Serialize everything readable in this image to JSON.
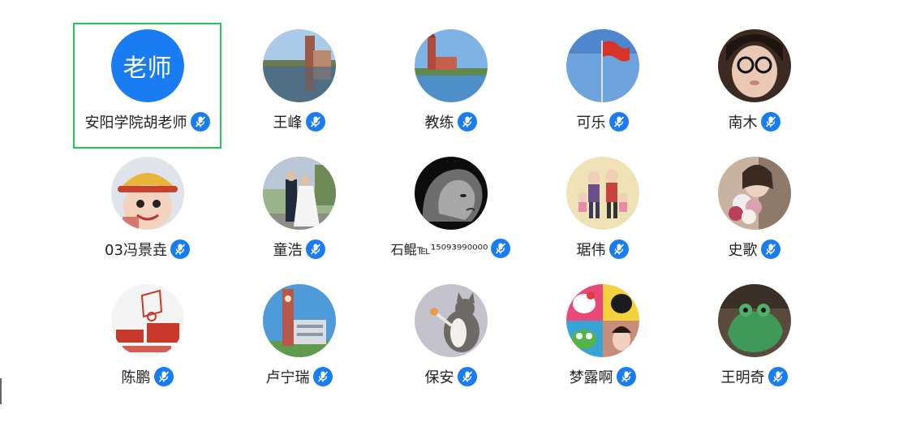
{
  "participants": [
    {
      "name": "安阳学院胡老师",
      "avatar_text": "老师",
      "avatar_type": "initials",
      "avatar_color": "#1a7cf2",
      "selected": true
    },
    {
      "name": "王峰",
      "avatar_type": "photo",
      "avatar_icon": "lake-building-photo"
    },
    {
      "name": "教练",
      "avatar_type": "photo",
      "avatar_icon": "tower-lake-photo"
    },
    {
      "name": "可乐",
      "avatar_type": "photo",
      "avatar_icon": "flag-sky-photo"
    },
    {
      "name": "南木",
      "avatar_type": "photo",
      "avatar_icon": "girl-glasses-photo"
    },
    {
      "name": "03冯景垚",
      "avatar_type": "photo",
      "avatar_icon": "anime-character-photo"
    },
    {
      "name": "童浩",
      "avatar_type": "photo",
      "avatar_icon": "wedding-couple-photo"
    },
    {
      "name": "石鲲℡¹⁵⁰⁹³⁹⁹⁰⁰⁰⁰",
      "avatar_type": "photo",
      "avatar_icon": "lion-photo"
    },
    {
      "name": "琚伟",
      "avatar_type": "photo",
      "avatar_icon": "family-cartoon-photo"
    },
    {
      "name": "史歌",
      "avatar_type": "photo",
      "avatar_icon": "girl-flowers-photo"
    },
    {
      "name": "陈鹏",
      "avatar_type": "photo",
      "avatar_icon": "basketball-logo-photo"
    },
    {
      "name": "卢宁瑞",
      "avatar_type": "photo",
      "avatar_icon": "clock-tower-photo"
    },
    {
      "name": "保安",
      "avatar_type": "photo",
      "avatar_icon": "cat-photo"
    },
    {
      "name": "梦露啊",
      "avatar_type": "photo",
      "avatar_icon": "cartoon-collage-photo"
    },
    {
      "name": "王明奇",
      "avatar_type": "photo",
      "avatar_icon": "frog-costume-photo"
    }
  ],
  "mic_icon": "microphone-icon",
  "colors": {
    "selected_border": "#22c55e",
    "mic_badge": "#1a7cf2"
  }
}
